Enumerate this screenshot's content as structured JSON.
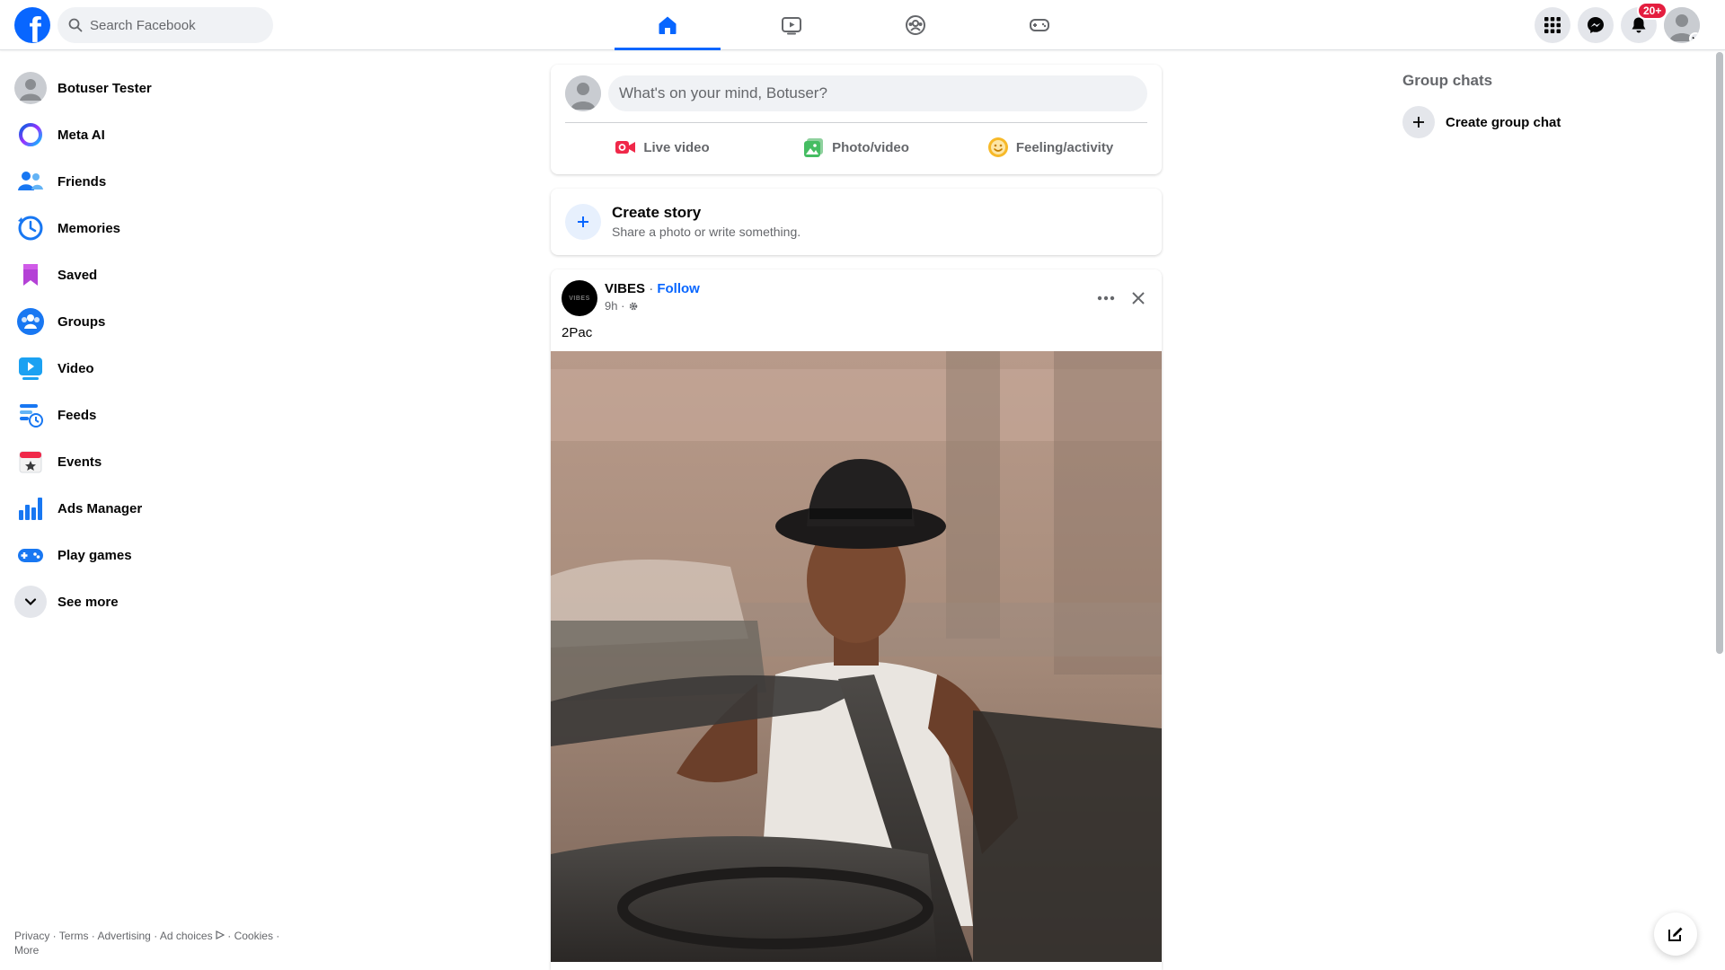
{
  "header": {
    "logo_letter": "f",
    "search_placeholder": "Search Facebook",
    "notification_badge": "20+",
    "brand_color": "#0866ff"
  },
  "nav_tabs": [
    {
      "name": "home",
      "icon": "home-icon",
      "active": true
    },
    {
      "name": "video",
      "icon": "video-play-icon",
      "active": false
    },
    {
      "name": "groups",
      "icon": "groups-icon",
      "active": false
    },
    {
      "name": "gaming",
      "icon": "gamepad-icon",
      "active": false
    }
  ],
  "sidebar": {
    "items": [
      {
        "label": "Botuser Tester",
        "icon": "profile-avatar-icon"
      },
      {
        "label": "Meta AI",
        "icon": "meta-ai-icon"
      },
      {
        "label": "Friends",
        "icon": "friends-icon"
      },
      {
        "label": "Memories",
        "icon": "memories-clock-icon"
      },
      {
        "label": "Saved",
        "icon": "bookmark-icon"
      },
      {
        "label": "Groups",
        "icon": "groups-icon"
      },
      {
        "label": "Video",
        "icon": "video-icon"
      },
      {
        "label": "Feeds",
        "icon": "feeds-icon"
      },
      {
        "label": "Events",
        "icon": "calendar-star-icon"
      },
      {
        "label": "Ads Manager",
        "icon": "bar-chart-icon"
      },
      {
        "label": "Play games",
        "icon": "gamepad-icon"
      },
      {
        "label": "See more",
        "icon": "chevron-down-icon"
      }
    ]
  },
  "footer": {
    "privacy": "Privacy",
    "terms": "Terms",
    "advertising": "Advertising",
    "ad_choices": "Ad choices",
    "cookies": "Cookies",
    "more": "More"
  },
  "composer": {
    "placeholder": "What's on your mind, Botuser?",
    "live_video": "Live video",
    "photo_video": "Photo/video",
    "feeling_activity": "Feeling/activity"
  },
  "story": {
    "title": "Create story",
    "subtitle": "Share a photo or write something."
  },
  "post": {
    "author": "VIBES",
    "avatar_text": "VIBES",
    "follow": "Follow",
    "separator": "·",
    "time": "9h",
    "time_separator": "·",
    "text": "2Pac"
  },
  "right_column": {
    "group_chats_title": "Group chats",
    "create_group_chat": "Create group chat"
  }
}
